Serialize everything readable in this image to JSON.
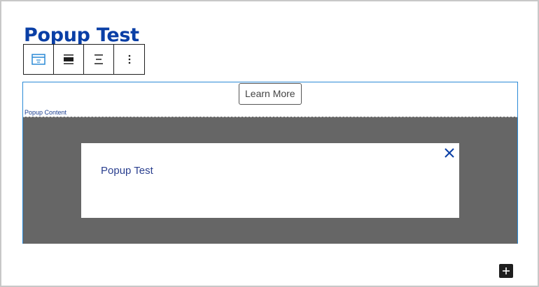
{
  "page": {
    "title": "Popup Test"
  },
  "toolbar": {
    "items": [
      {
        "icon": "popup-block-icon"
      },
      {
        "icon": "align-wide-icon"
      },
      {
        "icon": "align-center-icon"
      },
      {
        "icon": "more-options-icon"
      }
    ]
  },
  "block": {
    "button_label": "Learn More",
    "popup_label": "Popup Content",
    "popup": {
      "text": "Popup Test",
      "close_icon": "close-icon"
    }
  },
  "inserter": {
    "icon": "plus-icon"
  },
  "colors": {
    "title": "#0a3fa6",
    "selection_border": "#2b8ad6",
    "overlay": "#666666",
    "popup_text": "#2a3f8f",
    "close_icon": "#0a3fa6"
  }
}
